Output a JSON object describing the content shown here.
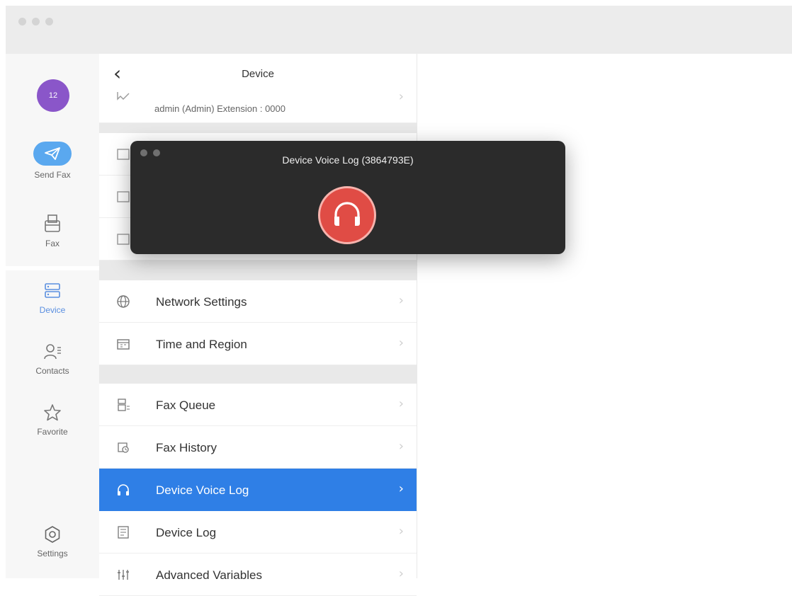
{
  "window": {
    "title": ""
  },
  "nav": {
    "avatar": "12",
    "items": [
      {
        "label": "Send Fax",
        "icon": "send-icon"
      },
      {
        "label": "Fax",
        "icon": "fax-icon"
      },
      {
        "label": "Device",
        "icon": "device-icon",
        "active": true
      },
      {
        "label": "Contacts",
        "icon": "contacts-icon"
      },
      {
        "label": "Favorite",
        "icon": "star-icon"
      },
      {
        "label": "Settings",
        "icon": "gear-icon"
      }
    ]
  },
  "list": {
    "back_icon": "chevron-left-icon",
    "title": "Device",
    "user_line": "admin (Admin)   Extension : 0000",
    "rows": [
      {
        "label": "Network Settings",
        "icon": "globe-icon"
      },
      {
        "label": "Time and Region",
        "icon": "calendar-icon"
      },
      {
        "label": "Fax Queue",
        "icon": "queue-icon"
      },
      {
        "label": "Fax History",
        "icon": "history-icon"
      },
      {
        "label": "Device Voice Log",
        "icon": "headphones-icon",
        "selected": true
      },
      {
        "label": "Device Log",
        "icon": "log-icon"
      },
      {
        "label": "Advanced Variables",
        "icon": "sliders-icon"
      }
    ]
  },
  "popup": {
    "title": "Device Voice Log (3864793E)",
    "button_icon": "headphones-icon"
  },
  "colors": {
    "accent": "#2f7fe6",
    "record": "#e04c45",
    "avatar": "#8a56c9"
  }
}
